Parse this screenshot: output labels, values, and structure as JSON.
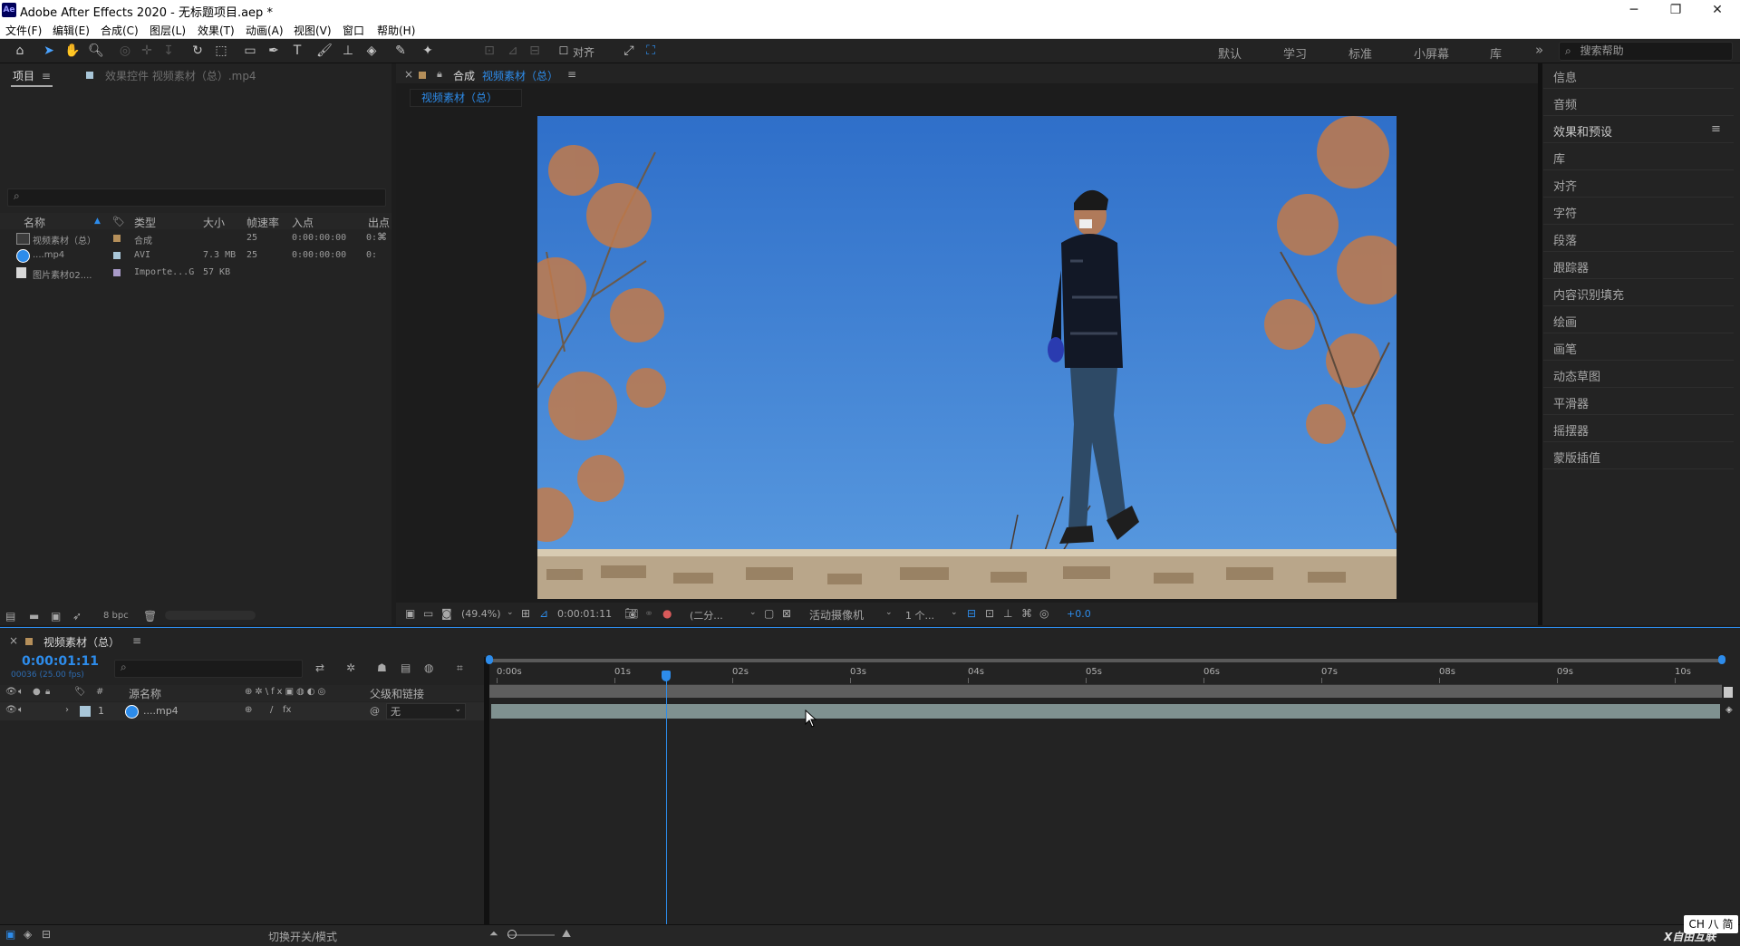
{
  "window": {
    "title": "Adobe After Effects 2020 - 无标题项目.aep *",
    "logo_text": "Ae",
    "minimize": "─",
    "restore": "❐",
    "close": "✕"
  },
  "menu": [
    "文件(F)",
    "编辑(E)",
    "合成(C)",
    "图层(L)",
    "效果(T)",
    "动画(A)",
    "视图(V)",
    "窗口",
    "帮助(H)"
  ],
  "toolbar": {
    "snap_label": "对齐",
    "workspaces": [
      "默认",
      "学习",
      "标准",
      "小屏幕",
      "库"
    ],
    "more": "»",
    "help_search_placeholder": "搜索帮助"
  },
  "project_panel": {
    "tab_label": "项目",
    "menu_glyph": "≡",
    "effects_tab_label": "效果控件 视频素材（总）.mp4",
    "search_icon": "⌕",
    "columns": [
      "名称",
      "类型",
      "大小",
      "帧速率",
      "入点",
      "出点"
    ],
    "rows": [
      {
        "name": "视频素材（总）",
        "color": "#b58f5a",
        "type": "合成",
        "size": "",
        "fps": "25",
        "in": "0:00:00:00",
        "out": "0:"
      },
      {
        "name": "....mp4",
        "color": "#a8c6d8",
        "type": "AVI",
        "size": "7.3 MB",
        "fps": "25",
        "in": "0:00:00:00",
        "out": "0:"
      },
      {
        "name": "图片素材02....",
        "color": "#a89ac8",
        "type": "Importe...G",
        "size": "57 KB",
        "fps": "",
        "in": "",
        "out": ""
      }
    ],
    "bpc": "8 bpc"
  },
  "comp_panel": {
    "tab_close": "×",
    "tab_prefix": "合成",
    "tab_name": "视频素材（总）",
    "menu_glyph": "≡",
    "sub_tab": "视频素材（总）",
    "zoom": "(49.4%)",
    "timecode": "0:00:01:11",
    "resolution": "(二分...",
    "camera": "活动摄像机",
    "views": "1 个...",
    "exposure": "+0.0"
  },
  "right_panel": {
    "items": [
      "信息",
      "音频",
      "效果和预设",
      "库",
      "对齐",
      "字符",
      "段落",
      "跟踪器",
      "内容识别填充",
      "绘画",
      "画笔",
      "动态草图",
      "平滑器",
      "摇摆器",
      "蒙版插值"
    ],
    "menu_glyph": "≡"
  },
  "timeline": {
    "tab_close": "×",
    "tab_name": "视频素材（总）",
    "menu_glyph": "≡",
    "timecode": "0:00:01:11",
    "frame_info": "00036 (25.00 fps)",
    "col_source": "源名称",
    "col_parent": "父级和链接",
    "layer_index": "1",
    "layer_name": "....mp4",
    "parent_value": "无",
    "ruler": [
      "0:00s",
      "01s",
      "02s",
      "03s",
      "04s",
      "05s",
      "06s",
      "07s",
      "08s",
      "09s",
      "10s"
    ],
    "playhead_seconds": 1.44,
    "duration_seconds": 10.4,
    "toggle_label": "切换开关/模式"
  },
  "system": {
    "ime": "CH 八 简",
    "watermark": "X自由互联"
  },
  "colors": {
    "accent": "#2d8ceb",
    "panel": "#232323",
    "bg": "#1d1d1d",
    "layer_bar": "#7f9190",
    "sky": "#3a7fcf"
  }
}
